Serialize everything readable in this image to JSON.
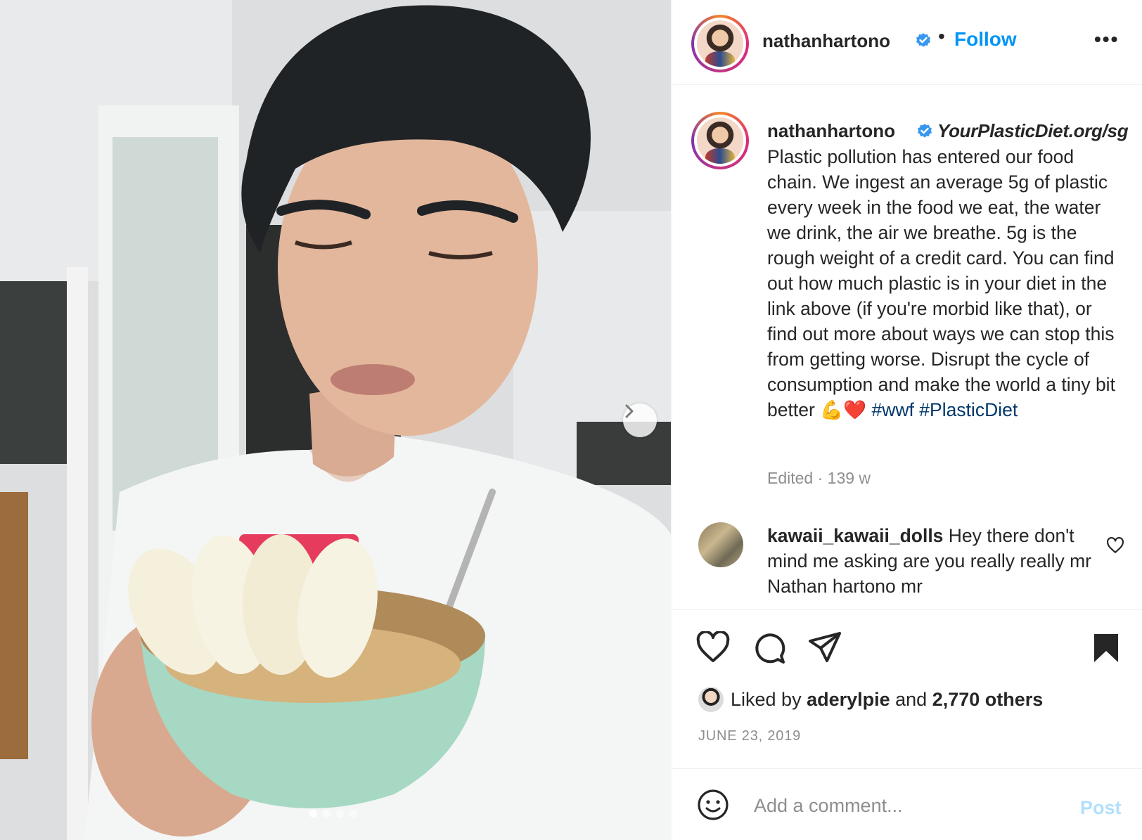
{
  "post": {
    "image_alt": "Man holding a bowl of granola with apple slices and a pink card",
    "carousel_dots": 4,
    "active_dot": 0
  },
  "header": {
    "username": "nathanhartono",
    "separator": "•",
    "follow_label": "Follow",
    "more_label": "•••"
  },
  "caption": {
    "username": "nathanhartono",
    "link": "YourPlasticDiet.org/sg",
    "text": "Plastic pollution has entered our food chain. We ingest an average 5g of plastic every week in the food we eat, the water we drink, the air we breathe. 5g is the rough weight of a credit card. You can find out how much plastic is in your diet in the link above (if you're morbid like that), or find out more about ways we can stop this from getting worse. Disrupt the cycle of consumption and make the world a tiny bit better ",
    "emoji": "💪❤️",
    "hashtags": [
      "#wwf",
      "#PlasticDiet"
    ],
    "edited": "Edited · 139 w"
  },
  "comment": {
    "username": "kawaii_kawaii_dolls",
    "text": " Hey there don't mind me asking are you really really mr Nathan hartono mr"
  },
  "likes": {
    "prefix": "Liked by ",
    "user": "aderylpie",
    "middle": " and ",
    "count": "2,770 others"
  },
  "date": "JUNE 23, 2019",
  "input": {
    "placeholder": "Add a comment...",
    "post_label": "Post"
  },
  "colors": {
    "accent": "#0095f6",
    "verified": "#3897f0",
    "hashtag": "#00376b",
    "muted": "#8e8e8e"
  },
  "icons": [
    "chevron-right-icon",
    "verified-icon",
    "more-icon",
    "heart-icon",
    "comment-icon",
    "share-icon",
    "bookmark-icon",
    "emoji-icon"
  ]
}
